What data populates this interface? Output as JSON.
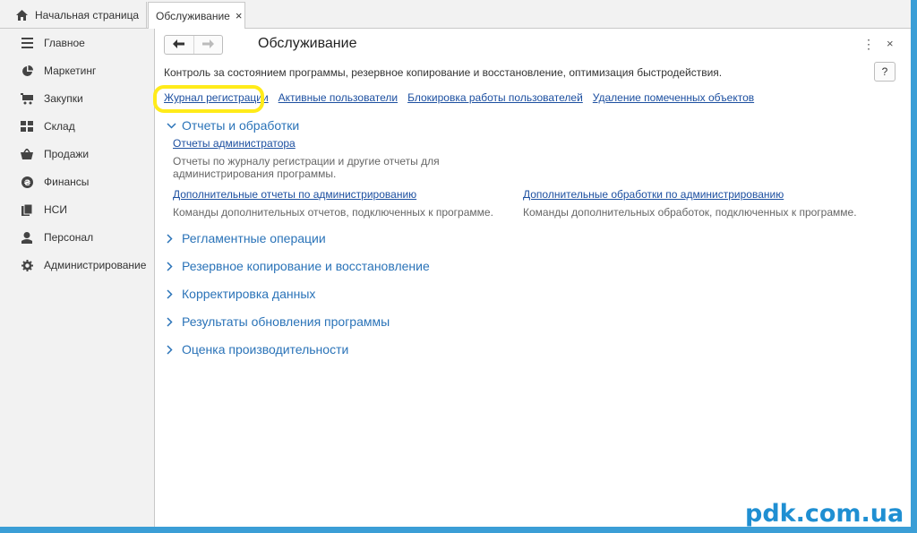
{
  "tabs": {
    "home_label": "Начальная страница",
    "active_label": "Обслуживание",
    "close_glyph": "×"
  },
  "sidebar": {
    "items": [
      {
        "label": "Главное",
        "icon": "list-icon"
      },
      {
        "label": "Маркетинг",
        "icon": "pie-chart-icon"
      },
      {
        "label": "Закупки",
        "icon": "cart-icon"
      },
      {
        "label": "Склад",
        "icon": "warehouse-icon"
      },
      {
        "label": "Продажи",
        "icon": "basket-icon"
      },
      {
        "label": "Финансы",
        "icon": "money-icon"
      },
      {
        "label": "НСИ",
        "icon": "book-icon"
      },
      {
        "label": "Персонал",
        "icon": "person-icon"
      },
      {
        "label": "Администрирование",
        "icon": "gear-icon"
      }
    ]
  },
  "header": {
    "title": "Обслуживание",
    "more_glyph": "⋮",
    "close_glyph": "×",
    "help_label": "?"
  },
  "description": "Контроль за состоянием программы, резервное копирование и восстановление, оптимизация быстродействия.",
  "top_links": [
    "Журнал регистрации",
    "Активные пользователи",
    "Блокировка работы пользователей",
    "Удаление помеченных объектов"
  ],
  "sections": {
    "reports": {
      "title": "Отчеты и обработки",
      "admin_reports_link": "Отчеты администратора",
      "admin_reports_desc_1": "Отчеты по журналу регистрации и другие отчеты для",
      "admin_reports_desc_2": "администрирования программы.",
      "extra_reports_link": "Дополнительные отчеты по администрированию",
      "extra_reports_desc": "Команды дополнительных отчетов, подключенных к программе.",
      "extra_processing_link": "Дополнительные обработки по администрированию",
      "extra_processing_desc": "Команды дополнительных обработок, подключенных к программе."
    },
    "collapsed": [
      "Регламентные операции",
      "Резервное копирование и восстановление",
      "Корректировка данных",
      "Результаты обновления программы",
      "Оценка производительности"
    ]
  },
  "watermark": "pdk.com.ua",
  "colors": {
    "link": "#1c4fa0",
    "section": "#2a73b8",
    "highlight": "#ffeb1a",
    "frame": "#3b9ed6"
  }
}
